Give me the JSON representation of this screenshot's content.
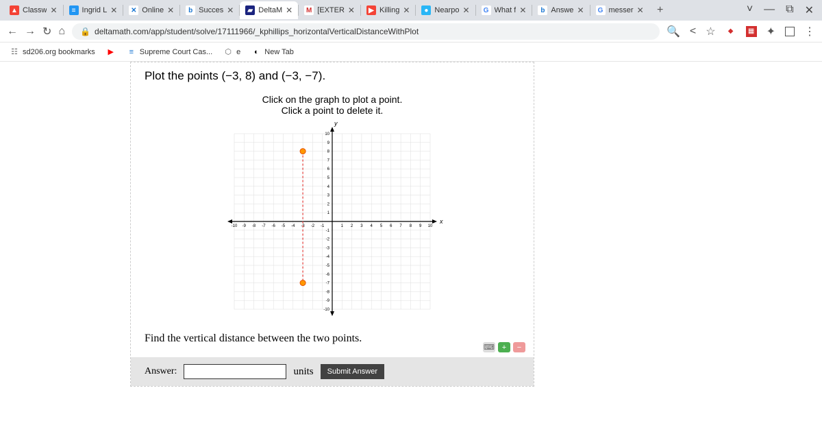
{
  "tabs": [
    {
      "title": "Classw",
      "favicon_bg": "#f44336",
      "favicon_color": "#fff",
      "favicon_text": "▲"
    },
    {
      "title": "Ingrid L",
      "favicon_bg": "#2196f3",
      "favicon_color": "#fff",
      "favicon_text": "≡"
    },
    {
      "title": "Online",
      "favicon_bg": "#fff",
      "favicon_color": "#1976d2",
      "favicon_text": "✕"
    },
    {
      "title": "Succes",
      "favicon_bg": "#fff",
      "favicon_color": "#1976d2",
      "favicon_text": "b"
    },
    {
      "title": "DeltaM",
      "favicon_bg": "#1a237e",
      "favicon_color": "#fff",
      "favicon_text": "▰",
      "active": true
    },
    {
      "title": "[EXTER",
      "favicon_bg": "#fff",
      "favicon_color": "#d32f2f",
      "favicon_text": "M"
    },
    {
      "title": "Killing",
      "favicon_bg": "#f44336",
      "favicon_color": "#fff",
      "favicon_text": "▶"
    },
    {
      "title": "Nearpo",
      "favicon_bg": "#29b6f6",
      "favicon_color": "#fff",
      "favicon_text": "●"
    },
    {
      "title": "What f",
      "favicon_bg": "#fff",
      "favicon_color": "#4285f4",
      "favicon_text": "G"
    },
    {
      "title": "Answe",
      "favicon_bg": "#fff",
      "favicon_color": "#1976d2",
      "favicon_text": "b"
    },
    {
      "title": "messer",
      "favicon_bg": "#fff",
      "favicon_color": "#4285f4",
      "favicon_text": "G"
    }
  ],
  "url": "deltamath.com/app/student/solve/17111966/_kphillips_horizontalVerticalDistanceWithPlot",
  "bookmarks": [
    {
      "label": "sd206.org bookmarks",
      "icon": "☷",
      "color": "#666"
    },
    {
      "label": "",
      "icon": "▶",
      "color": "#f00"
    },
    {
      "label": "Supreme Court Cas...",
      "icon": "≡",
      "color": "#1976d2"
    },
    {
      "label": "e",
      "icon": "⬡",
      "color": "#666"
    },
    {
      "label": "New Tab",
      "icon": "◐",
      "color": "#000"
    }
  ],
  "problem": {
    "title_prefix": "Plot the points ",
    "point1": "(−3, 8)",
    "conj": " and ",
    "point2": "(−3, −7)",
    "period": ".",
    "instr1": "Click on the graph to plot a point.",
    "instr2": "Click a point to delete it.",
    "question": "Find the vertical distance between the two points.",
    "answer_label": "Answer:",
    "units": "units",
    "submit": "Submit Answer",
    "answer_value": ""
  },
  "chart_data": {
    "type": "scatter",
    "title": "",
    "xlabel": "x",
    "ylabel": "y",
    "xlim": [
      -10,
      10
    ],
    "ylim": [
      -10,
      10
    ],
    "xticks": [
      -10,
      -9,
      -8,
      -7,
      -6,
      -5,
      -4,
      -3,
      -2,
      -1,
      1,
      2,
      3,
      4,
      5,
      6,
      7,
      8,
      9,
      10
    ],
    "yticks": [
      -10,
      -9,
      -8,
      -7,
      -6,
      -5,
      -4,
      -3,
      -2,
      -1,
      1,
      2,
      3,
      4,
      5,
      6,
      7,
      8,
      9,
      10
    ],
    "points": [
      {
        "x": -3,
        "y": 8
      },
      {
        "x": -3,
        "y": -7
      }
    ],
    "dashed_segment": {
      "x1": -3,
      "y1": 8,
      "x2": -3,
      "y2": -7
    }
  }
}
